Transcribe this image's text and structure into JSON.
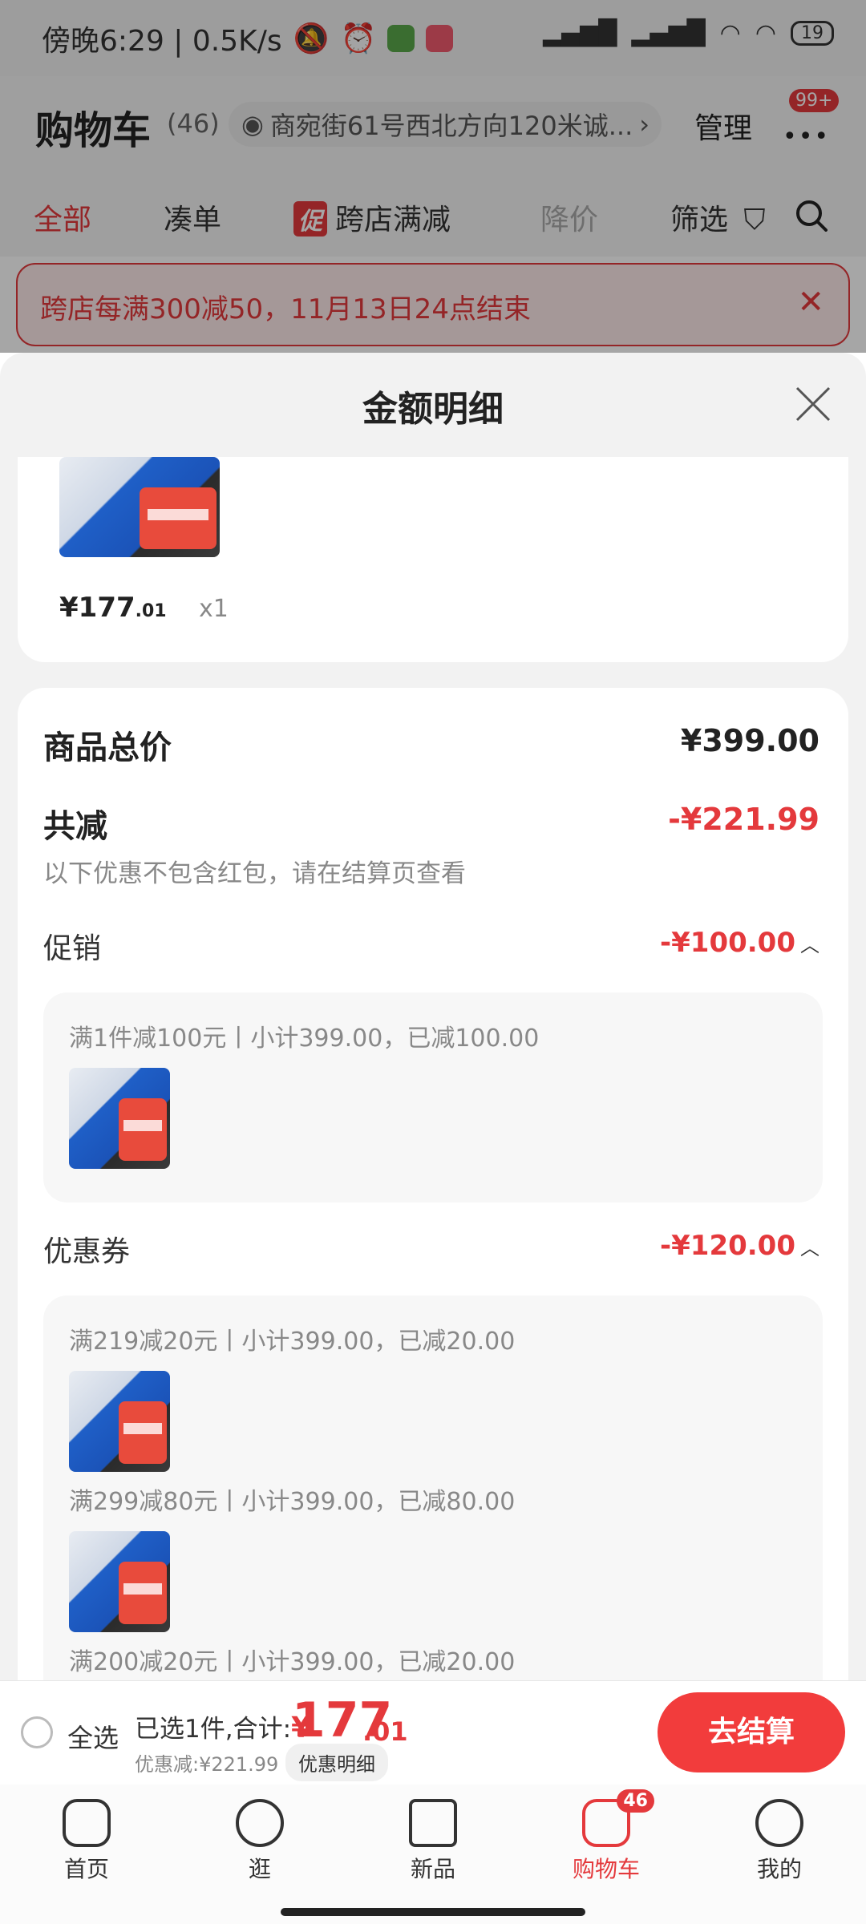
{
  "status_bar": {
    "left_text": "傍晚6:29 | 0.5K/s",
    "battery": "19",
    "icons": [
      "mute-icon",
      "alarm-icon",
      "wechat-icon",
      "app-icon",
      "signal-icon",
      "signal-icon",
      "wifi-icon",
      "wifi-icon",
      "battery-icon"
    ]
  },
  "header": {
    "title": "购物车",
    "count": "(46)",
    "address": "商宛街61号西北方向120米诚...",
    "manage": "管理",
    "more_badge": "99+"
  },
  "tabs": {
    "all": "全部",
    "bundle": "凑单",
    "promo_badge": "促",
    "cross_store": "跨店满减",
    "price_drop": "降价",
    "filter": "筛选"
  },
  "banner": {
    "text": "跨店每满300减50，11月13日24点结束"
  },
  "sheet": {
    "title": "金额明细",
    "top_item": {
      "price_int": "¥177",
      "price_dec": ".01",
      "qty": "x1"
    },
    "total_label": "商品总价",
    "total_value": "¥399.00",
    "reduce_label": "共减",
    "reduce_value": "-¥221.99",
    "note": "以下优惠不包含红包，请在结算页查看",
    "promo": {
      "label": "促销",
      "value": "-¥100.00",
      "lines": [
        "满1件减100元丨小计399.00，已减100.00"
      ]
    },
    "coupon": {
      "label": "优惠券",
      "value": "-¥120.00",
      "lines": [
        "满219减20元丨小计399.00，已减20.00",
        "满299减80元丨小计399.00，已减80.00",
        "满200减20元丨小计399.00，已减20.00"
      ]
    }
  },
  "footer": {
    "select_all": "全选",
    "selected_summary": "已选1件,合计:",
    "currency": "¥",
    "total_int": "177",
    "total_dec": ".01",
    "saved": "优惠减:¥221.99",
    "detail_button": "优惠明细",
    "checkout": "去结算"
  },
  "tabbar": {
    "items": [
      {
        "label": "首页",
        "icon": "home-icon"
      },
      {
        "label": "逛",
        "icon": "explore-icon"
      },
      {
        "label": "新品",
        "icon": "box-icon"
      },
      {
        "label": "购物车",
        "icon": "cart-icon",
        "badge": "46"
      },
      {
        "label": "我的",
        "icon": "profile-icon"
      }
    ]
  },
  "colors": {
    "accent": "#e4393c",
    "checkout": "#f23c3c"
  }
}
